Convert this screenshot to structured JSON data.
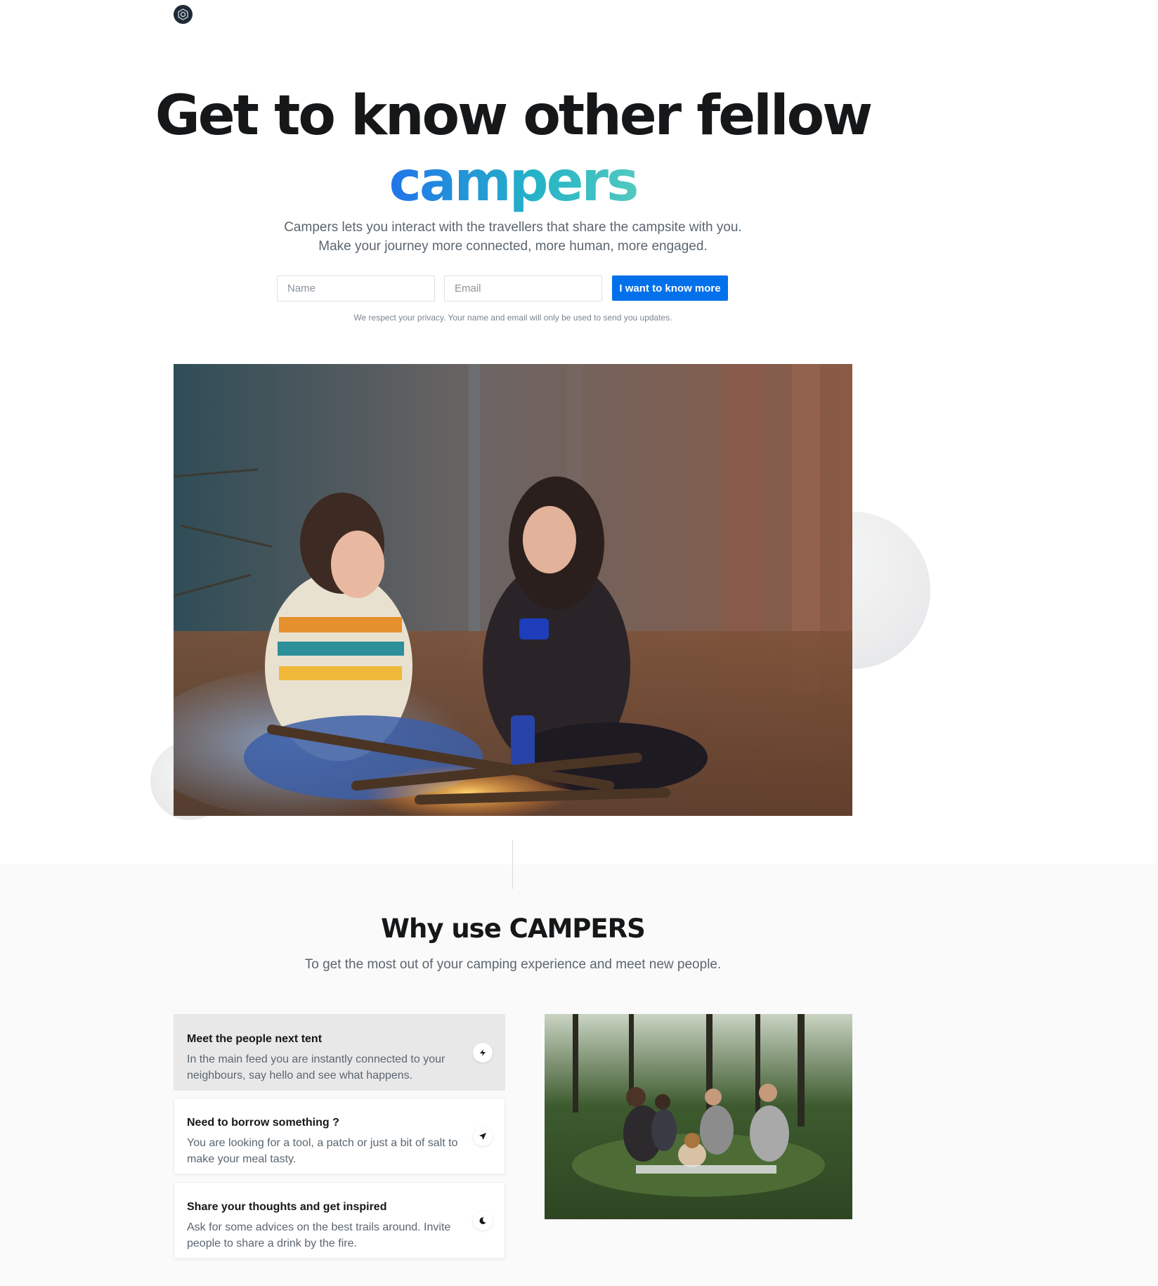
{
  "brand": {
    "logo_icon": "camp-logo-icon"
  },
  "hero": {
    "title_line1": "Get to know other fellow",
    "title_accent": "campers",
    "subtitle_line1": "Campers lets you interact with the travellers that share the campsite with you.",
    "subtitle_line2": "Make your journey more connected, more human, more engaged.",
    "form": {
      "name_placeholder": "Name",
      "email_placeholder": "Email",
      "cta_label": "I want to know more"
    },
    "privacy_note": "We respect your privacy. Your name and email will only be used to send you updates.",
    "accent_gradient": [
      "#2174ea",
      "#25b4c6",
      "#52c9c0"
    ],
    "cta_color": "#0270eb"
  },
  "features": {
    "title": "Why use CAMPERS",
    "subtitle": "To get the most out of your camping experience and meet new people.",
    "items": [
      {
        "title": "Meet the people next tent",
        "text": "In the main feed you are instantly connected to your neighbours, say hello and see what happens.",
        "icon": "lightning-icon",
        "active": true
      },
      {
        "title": "Need to borrow something ?",
        "text": "You are looking for a tool, a patch or just a bit of salt to make your meal tasty.",
        "icon": "paper-plane-icon",
        "active": false
      },
      {
        "title": "Share your thoughts and get inspired",
        "text": "Ask for some advices on the best trails around. Invite people to share a drink by the fire.",
        "icon": "moon-icon",
        "active": false
      }
    ]
  }
}
